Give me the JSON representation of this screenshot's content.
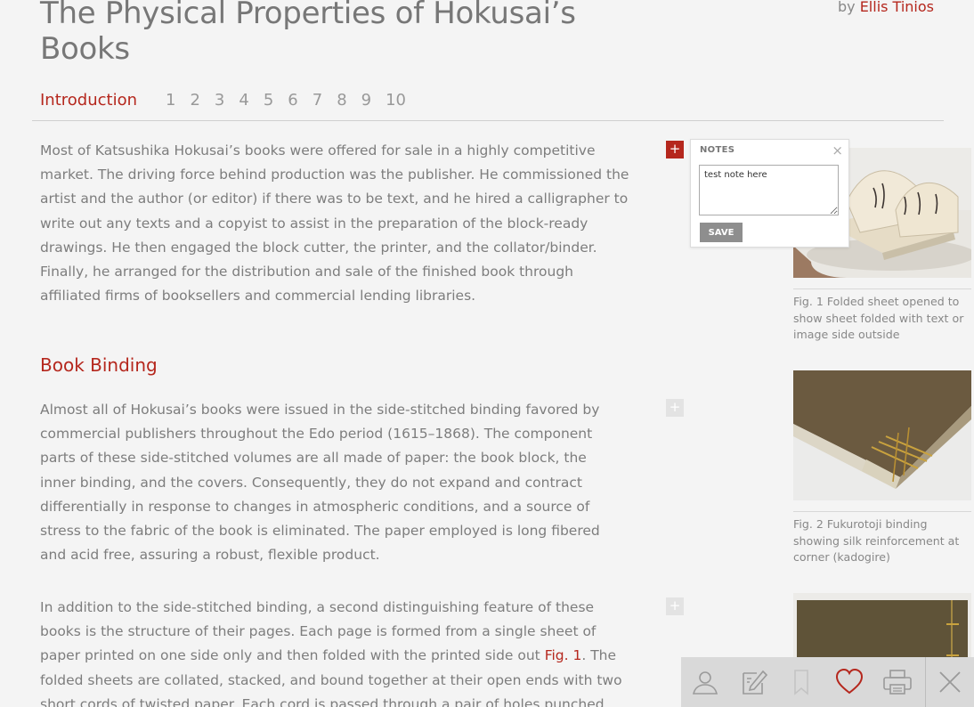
{
  "header": {
    "title": "The Physical Properties of Hokusai’s Books",
    "byline_prefix": "by",
    "author": "Ellis Tinios"
  },
  "nav": {
    "intro_label": "Introduction",
    "pages": [
      "1",
      "2",
      "3",
      "4",
      "5",
      "6",
      "7",
      "8",
      "9",
      "10"
    ]
  },
  "content": {
    "intro_paragraph": "Most of Katsushika Hokusai’s books were offered for sale in a highly competitive market. The driving force behind production was the publisher. He commissioned the artist and the author (or editor) if there was to be text, and he hired a calligrapher to write out any texts and a copyist to assist in the preparation of the block-ready drawings. He then engaged the block cutter, the printer, and the collator/binder. Finally, he arranged for the distribution and sale of the finished book through affiliated firms of booksellers and commercial lending libraries.",
    "section_heading": "Book Binding",
    "binding_paragraph": "Almost all of Hokusai’s books were issued in the side-stitched binding favored by commercial publishers throughout the Edo period (1615–1868). The component parts of these side-stitched volumes are all made of paper: the book block, the inner binding, and the covers. Consequently, they do not expand and contract differentially in response to changes in atmospheric conditions, and a source of stress to the fabric of the book is eliminated. The paper employed is long fibered and acid free, assuring a robust, flexible product.",
    "pages_paragraph_part1": "In addition to the side-stitched binding, a second distinguishing feature of these books is the structure of their pages. Each page is formed from a single sheet of paper printed on one side only and then folded with the printed side out ",
    "pages_paragraph_link": "Fig. 1",
    "pages_paragraph_part2": ". The folded sheets are collated, stacked, and bound together at their open ends with two short cords of twisted paper. Each cord is passed through a pair of holes punched through the stacked sheets and"
  },
  "note_buttons": {
    "add_symbol": "+"
  },
  "notes_popup": {
    "title": "NOTES",
    "close_symbol": "×",
    "textarea_value": "test note here",
    "save_label": "SAVE"
  },
  "figures": [
    {
      "caption": "Fig. 1 Folded sheet opened to show sheet folded with text or image side outside"
    },
    {
      "caption": "Fig. 2 Fukurotoji binding showing silk reinforcement at corner (kadogire)"
    }
  ],
  "toolbar": {
    "icons": [
      "user-icon",
      "edit-note-icon",
      "bookmark-icon",
      "heart-icon",
      "print-icon",
      "close-icon"
    ],
    "accent_color": "#b5271d",
    "icon_color": "#9a9a9a"
  },
  "colors": {
    "accent": "#b5271d",
    "background": "#f4f4f4",
    "text": "#7d7d7d"
  }
}
